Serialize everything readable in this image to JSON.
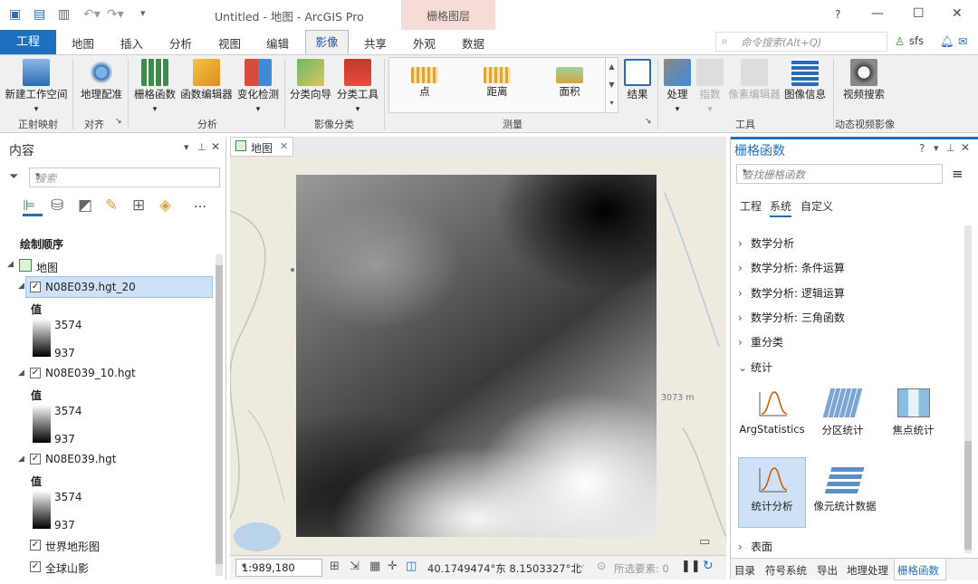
{
  "window": {
    "title": "Untitled - 地图 - ArcGIS Pro",
    "context_tab_group": "栅格图层",
    "help": "?",
    "minimize": "—",
    "maximize": "☐",
    "close": "✕"
  },
  "tabs": {
    "project": "工程",
    "items": [
      "地图",
      "插入",
      "分析",
      "视图",
      "编辑",
      "影像",
      "共享",
      "外观",
      "数据"
    ],
    "active": "影像"
  },
  "command_search": {
    "placeholder": "命令搜索(Alt+Q)"
  },
  "user": {
    "name": "sfs"
  },
  "ribbon": {
    "buttons": {
      "new_workspace": "新建工作空间",
      "georeference": "地理配准",
      "raster_functions": "栅格函数",
      "function_editor": "函数编辑器",
      "change_detection": "变化检测",
      "classify_wizard": "分类向导",
      "classify_tools": "分类工具",
      "point": "点",
      "distance": "距离",
      "area": "面积",
      "results": "结果",
      "process": "处理",
      "index": "指数",
      "pixel_editor": "像素编辑器",
      "image_info": "图像信息",
      "video_search": "视频搜索"
    },
    "groups": {
      "ortho": "正射映射",
      "align": "对齐",
      "analysis": "分析",
      "classification": "影像分类",
      "measure": "测量",
      "tools": "工具",
      "motion_imagery": "动态视频影像"
    }
  },
  "contents": {
    "title": "内容",
    "search_placeholder": "搜索",
    "drawing_order": "绘制顺序",
    "map_label": "地图",
    "layers": [
      {
        "name": "N08E039.hgt_20",
        "value_label": "值",
        "high": "3574",
        "low": "937",
        "checked": true
      },
      {
        "name": "N08E039_10.hgt",
        "value_label": "值",
        "high": "3574",
        "low": "937",
        "checked": true
      },
      {
        "name": "N08E039.hgt",
        "value_label": "值",
        "high": "3574",
        "low": "937",
        "checked": true
      }
    ],
    "basemaps": [
      "世界地形图",
      "全球山影"
    ]
  },
  "map": {
    "tab_label": "地图",
    "scale": "1:989,180",
    "coordinates": "40.1749474°东 8.1503327°北",
    "selected_features": "所选要素: 0",
    "label_3073": "3073 m"
  },
  "raster_functions_pane": {
    "title": "栅格函数",
    "search_placeholder": "查找栅格函数",
    "tabs": [
      "工程",
      "系统",
      "自定义"
    ],
    "active_tab": "系统",
    "categories": [
      {
        "label": "数学分析",
        "expanded": false
      },
      {
        "label": "数学分析: 条件运算",
        "expanded": false
      },
      {
        "label": "数学分析: 逻辑运算",
        "expanded": false
      },
      {
        "label": "数学分析: 三角函数",
        "expanded": false
      },
      {
        "label": "重分类",
        "expanded": false
      },
      {
        "label": "统计",
        "expanded": true
      }
    ],
    "stat_functions": [
      "ArgStatistics",
      "分区统计",
      "焦点统计",
      "统计分析",
      "像元统计数据"
    ],
    "selected_function": "统计分析",
    "next_category": "表面",
    "bottom_tabs": [
      "目录",
      "符号系统",
      "导出",
      "地理处理",
      "栅格函数"
    ],
    "active_bottom_tab": "栅格函数"
  }
}
